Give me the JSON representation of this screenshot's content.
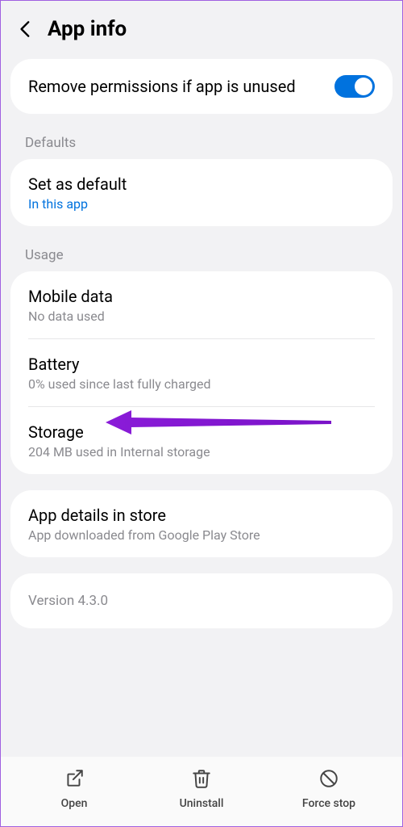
{
  "header": {
    "title": "App info"
  },
  "permissions": {
    "remove_label": "Remove permissions if app is unused",
    "toggle_on": true
  },
  "sections": {
    "defaults_label": "Defaults",
    "usage_label": "Usage"
  },
  "defaults": {
    "set_default_label": "Set as default",
    "set_default_sub": "In this app"
  },
  "usage": {
    "mobile_data_label": "Mobile data",
    "mobile_data_sub": "No data used",
    "battery_label": "Battery",
    "battery_sub": "0% used since last fully charged",
    "storage_label": "Storage",
    "storage_sub": "204 MB used in Internal storage"
  },
  "store": {
    "label": "App details in store",
    "sub": "App downloaded from Google Play Store"
  },
  "version": {
    "label": "Version 4.3.0"
  },
  "bottom": {
    "open": "Open",
    "uninstall": "Uninstall",
    "force_stop": "Force stop"
  }
}
